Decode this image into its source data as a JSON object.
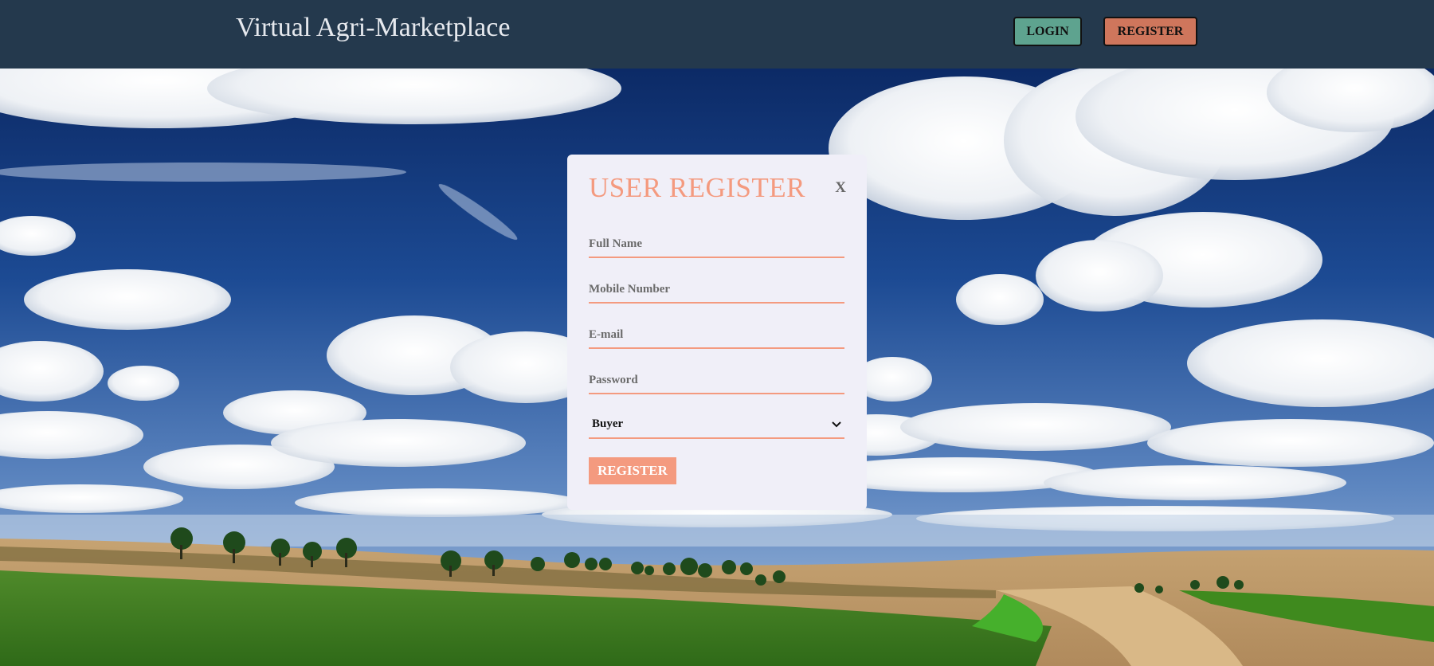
{
  "header": {
    "brand": "Virtual Agri-Marketplace",
    "login_label": "LOGIN",
    "register_label": "REGISTER"
  },
  "modal": {
    "title": "USER REGISTER",
    "close_label": "X",
    "full_name_placeholder": "Full Name",
    "mobile_placeholder": "Mobile Number",
    "email_placeholder": "E-mail",
    "password_placeholder": "Password",
    "role_selected": "Buyer",
    "submit_label": "REGISTER"
  },
  "colors": {
    "header_bg": "#24394d",
    "accent": "#f49a7f",
    "login_btn": "#5ea38f",
    "register_btn": "#cf765c",
    "modal_bg": "#f0eff8"
  }
}
